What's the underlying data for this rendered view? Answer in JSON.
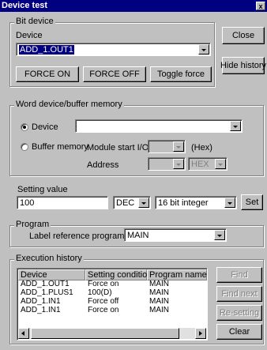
{
  "window": {
    "title": "Device test",
    "close_glyph": "x"
  },
  "bit_device": {
    "legend": "Bit device",
    "device_label": "Device",
    "device_value": "ADD_1.OUT1",
    "force_on": "FORCE ON",
    "force_off": "FORCE OFF",
    "toggle_force": "Toggle force"
  },
  "side_buttons": {
    "close": "Close",
    "hide_history": "Hide history"
  },
  "word_device": {
    "legend": "Word device/buffer memory",
    "device_radio": "Device",
    "buffer_radio": "Buffer memory",
    "module_start_label": "Module start I/O",
    "hex_label": "(Hex)",
    "address_label": "Address",
    "address_format": "HEX",
    "selected": "device"
  },
  "setting": {
    "label": "Setting value",
    "value": "100",
    "radix": "DEC",
    "data_type": "16 bit integer",
    "set_button": "Set"
  },
  "program": {
    "legend": "Program",
    "label": "Label reference program",
    "value": "MAIN"
  },
  "history": {
    "legend": "Execution history",
    "columns": [
      "Device",
      "Setting condition",
      "Program name"
    ],
    "rows": [
      [
        "ADD_1.OUT1",
        "Force on",
        "MAIN"
      ],
      [
        "ADD_1.PLUS1",
        "100(D)",
        "MAIN"
      ],
      [
        "ADD_1.IN1",
        "Force off",
        "MAIN"
      ],
      [
        "ADD_1.IN1",
        "Force on",
        "MAIN"
      ]
    ],
    "find": "Find",
    "find_next": "Find next",
    "resetting": "Re-setting",
    "clear": "Clear"
  }
}
